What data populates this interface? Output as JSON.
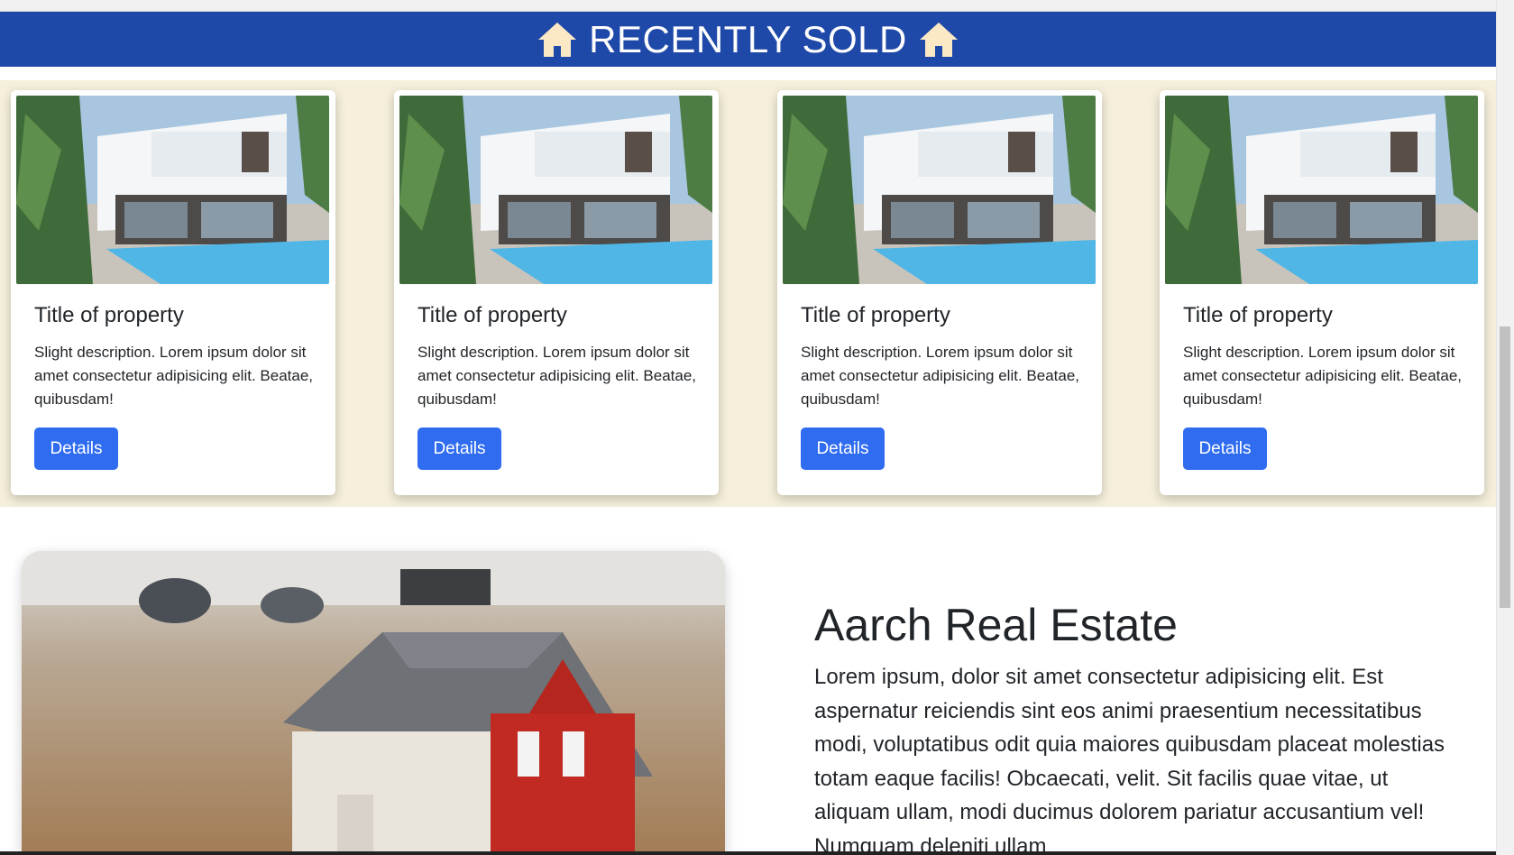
{
  "section": {
    "title": "RECENTLY SOLD",
    "icon": "house-icon"
  },
  "properties": [
    {
      "title": "Title of property",
      "description": "Slight description. Lorem ipsum dolor sit amet consectetur adipisicing elit. Beatae, quibusdam!",
      "button": "Details"
    },
    {
      "title": "Title of property",
      "description": "Slight description. Lorem ipsum dolor sit amet consectetur adipisicing elit. Beatae, quibusdam!",
      "button": "Details"
    },
    {
      "title": "Title of property",
      "description": "Slight description. Lorem ipsum dolor sit amet consectetur adipisicing elit. Beatae, quibusdam!",
      "button": "Details"
    },
    {
      "title": "Title of property",
      "description": "Slight description. Lorem ipsum dolor sit amet consectetur adipisicing elit. Beatae, quibusdam!",
      "button": "Details"
    }
  ],
  "about": {
    "title": "Aarch Real Estate",
    "text": "Lorem ipsum, dolor sit amet consectetur adipisicing elit. Est aspernatur reiciendis sint eos animi praesentium necessitatibus modi, voluptatibus odit quia maiores quibusdam placeat molestias totam eaque facilis! Obcaecati, velit. Sit facilis quae vitae, ut aliquam ullam, modi ducimus dolorem pariatur accusantium vel! Numquam deleniti ullam"
  },
  "colors": {
    "banner": "#1f49a8",
    "band": "#f5efdb",
    "button": "#2f6cf0",
    "house_icon": "#fbe9c6"
  }
}
